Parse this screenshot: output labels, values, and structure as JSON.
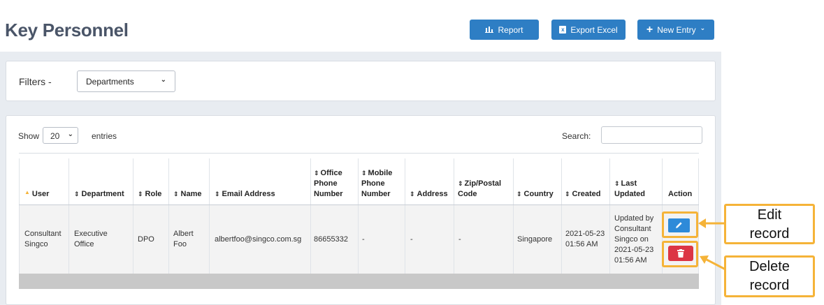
{
  "page": {
    "title": "Key Personnel"
  },
  "toolbar": {
    "report_label": "Report",
    "export_label": "Export Excel",
    "new_entry_label": "New Entry"
  },
  "filters": {
    "label": "Filters -",
    "department_select": "Departments"
  },
  "table_controls": {
    "show_label": "Show",
    "page_size": "20",
    "entries_label": "entries",
    "search_label": "Search:",
    "search_value": ""
  },
  "table": {
    "headers": {
      "user": "User",
      "department": "Department",
      "role": "Role",
      "name": "Name",
      "email": "Email Address",
      "office_phone": "Office Phone Number",
      "mobile_phone": "Mobile Phone Number",
      "address": "Address",
      "zip": "Zip/Postal Code",
      "country": "Country",
      "created": "Created",
      "last_updated": "Last Updated",
      "action": "Action"
    },
    "rows": [
      {
        "user": "Consultant Singco",
        "department": "Executive Office",
        "role": "DPO",
        "name": "Albert Foo",
        "email": "albertfoo@singco.com.sg",
        "office_phone": "86655332",
        "mobile_phone": "-",
        "address": "-",
        "zip": "-",
        "country": "Singapore",
        "created": "2021-05-23 01:56 AM",
        "last_updated": "Updated by Consultant Singco on 2021-05-23 01:56 AM"
      }
    ]
  },
  "annotations": {
    "edit": "Edit record",
    "delete": "Delete record"
  },
  "icons": {
    "report": "bar-chart-icon",
    "export": "excel-file-icon",
    "new": "plus-icon",
    "edit": "pencil-icon",
    "delete": "trash-icon",
    "sort": "sort-icon"
  },
  "colors": {
    "primary": "#2e7ec4",
    "danger": "#dc3545",
    "highlight": "#f5b338",
    "title": "#4a5568"
  }
}
